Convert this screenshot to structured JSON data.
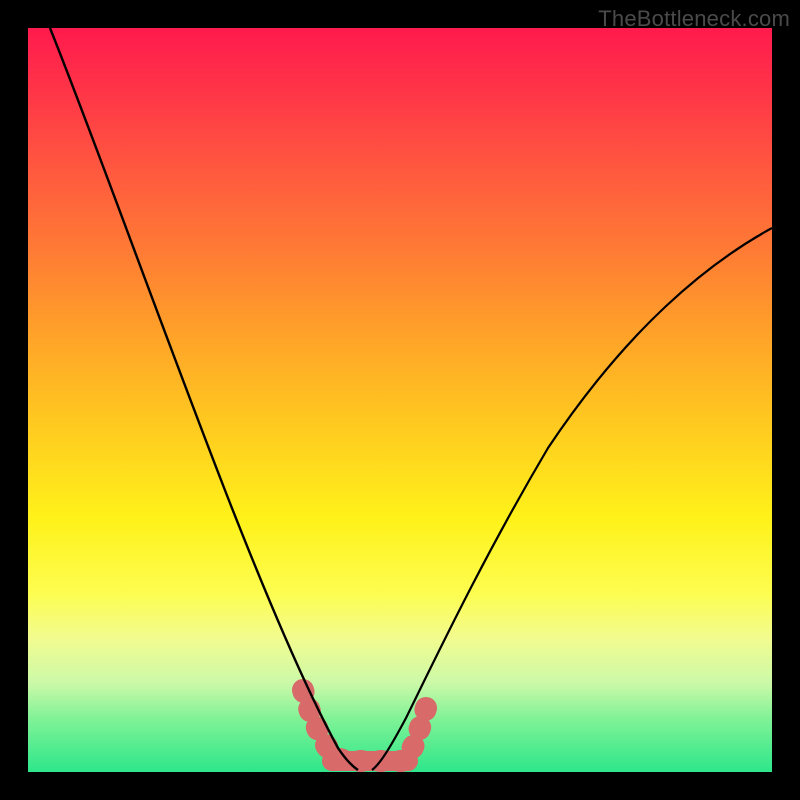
{
  "watermark": "TheBottleneck.com",
  "chart_data": {
    "type": "line",
    "title": "",
    "xlabel": "",
    "ylabel": "",
    "xlim": [
      0,
      100
    ],
    "ylim": [
      0,
      100
    ],
    "background_gradient": {
      "top_color": "#ff1a4d",
      "mid_color": "#fff21a",
      "bottom_color": "#2ee68a",
      "meaning": "top=high bottleneck (red), bottom=low bottleneck (green)"
    },
    "series": [
      {
        "name": "left-curve",
        "stroke": "#000000",
        "x": [
          3,
          6,
          10,
          14,
          18,
          22,
          26,
          30,
          33,
          36,
          38,
          40,
          41.5,
          43
        ],
        "y": [
          100,
          90,
          78,
          66,
          55,
          44,
          34,
          25,
          18,
          12,
          8,
          5,
          3,
          1.5
        ]
      },
      {
        "name": "right-curve",
        "stroke": "#000000",
        "x": [
          46,
          48,
          50,
          53,
          57,
          62,
          68,
          75,
          82,
          90,
          100
        ],
        "y": [
          1.5,
          4,
          8,
          14,
          22,
          32,
          42,
          52,
          60,
          67,
          73
        ]
      },
      {
        "name": "valley-highlight",
        "stroke": "#d86a6a",
        "marker": "round-band",
        "x": [
          37,
          38.5,
          40,
          41.5,
          43,
          44.5,
          46,
          47.5,
          49,
          50.5
        ],
        "y": [
          11,
          7,
          4,
          2.5,
          2,
          2,
          2.5,
          4,
          6.5,
          10
        ]
      }
    ]
  }
}
